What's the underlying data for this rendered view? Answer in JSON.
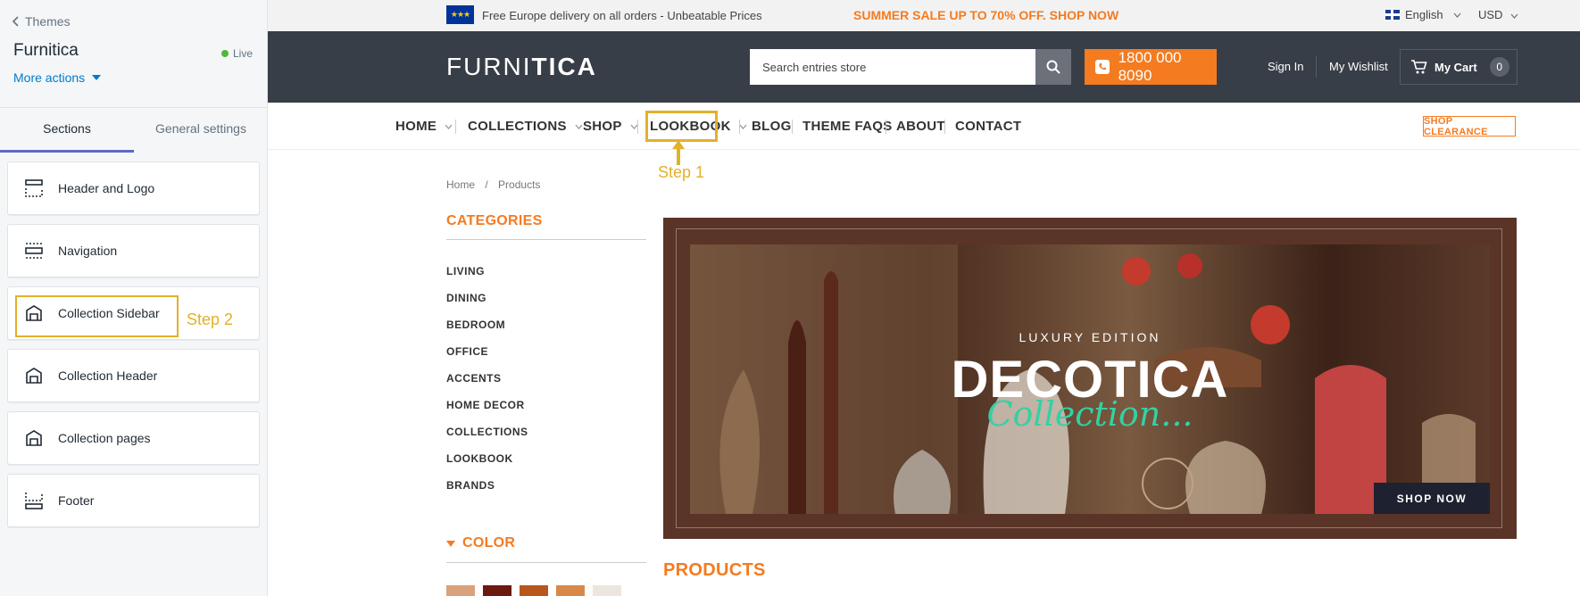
{
  "editor": {
    "back_label": "Themes",
    "theme_name": "Furnitica",
    "status": "Live",
    "more_actions": "More actions",
    "tabs": [
      {
        "label": "Sections"
      },
      {
        "label": "General settings"
      }
    ],
    "sections": [
      {
        "label": "Header and Logo",
        "icon": "header-layout-icon"
      },
      {
        "label": "Navigation",
        "icon": "navigation-layout-icon"
      },
      {
        "label": "Collection Sidebar",
        "icon": "collection-icon"
      },
      {
        "label": "Collection Header",
        "icon": "collection-icon"
      },
      {
        "label": "Collection pages",
        "icon": "collection-icon"
      },
      {
        "label": "Footer",
        "icon": "footer-layout-icon"
      }
    ],
    "step2_label": "Step 2",
    "accent_color": "#5c6ac4",
    "link_color": "#007ace",
    "highlight_color": "#e2b12a"
  },
  "store": {
    "topbar": {
      "delivery": "Free Europe delivery on all orders - Unbeatable Prices",
      "sale": "SUMMER SALE UP TO 70% OFF. SHOP NOW",
      "language": "English",
      "currency": "USD"
    },
    "header": {
      "logo_light": "FURNI",
      "logo_bold": "TICA",
      "search_placeholder": "Search entries store",
      "phone": "1800 000 8090",
      "sign_in": "Sign In",
      "wishlist": "My Wishlist",
      "cart_label": "My Cart",
      "cart_count": "0"
    },
    "nav": {
      "items": [
        {
          "label": "HOME"
        },
        {
          "label": "COLLECTIONS"
        },
        {
          "label": "SHOP"
        },
        {
          "label": "LOOKBOOK"
        },
        {
          "label": "BLOG"
        },
        {
          "label": "THEME FAQS"
        },
        {
          "label": "ABOUT"
        },
        {
          "label": "CONTACT"
        }
      ],
      "clearance": "SHOP CLEARANCE"
    },
    "step1_label": "Step 1",
    "breadcrumb": {
      "home": "Home",
      "sep": "/",
      "current": "Products"
    },
    "categories": {
      "title": "CATEGORIES",
      "items": [
        "LIVING",
        "DINING",
        "BEDROOM",
        "OFFICE",
        "ACCENTS",
        "HOME DECOR",
        "COLLECTIONS",
        "LOOKBOOK",
        "BRANDS"
      ]
    },
    "color_title": "COLOR",
    "color_swatches": [
      "#d9a27a",
      "#6b1a10",
      "#b8561e",
      "#d8894a",
      "#ece6df"
    ],
    "banner": {
      "eyebrow": "LUXURY EDITION",
      "title": "DECOTICA",
      "script": "Collection...",
      "cta": "SHOP NOW"
    },
    "products_title": "PRODUCTS",
    "accent_color": "#f47b20",
    "header_bg": "#383e47"
  }
}
